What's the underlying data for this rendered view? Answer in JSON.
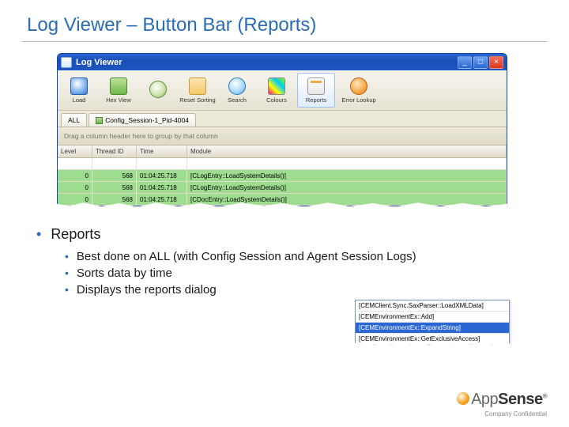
{
  "slide": {
    "title": "Log Viewer – Button Bar (Reports)"
  },
  "window": {
    "title": "Log Viewer",
    "min_label": "_",
    "max_label": "□",
    "close_label": "×"
  },
  "toolbar": {
    "load": "Load",
    "hex": "Hex View",
    "clock": "",
    "reset": "Reset Sorting",
    "search": "Search",
    "colors": "Colours",
    "reports": "Reports",
    "error": "Error Lookup"
  },
  "tabs": {
    "all": "ALL",
    "session": "Config_Session-1_Pid-4004"
  },
  "groupbar": "Drag a column header here to group by that column",
  "columns": {
    "level": "Level",
    "threadid": "Thread ID",
    "time": "Time",
    "module": "Module"
  },
  "rows": [
    {
      "level": "0",
      "tid": "568",
      "time": "01:04:25.718",
      "module": "[CLogEntry::LoadSystemDetails()]"
    },
    {
      "level": "0",
      "tid": "568",
      "time": "01:04:25.718",
      "module": "[CLogEntry::LoadSystemDetails()]"
    },
    {
      "level": "0",
      "tid": "568",
      "time": "01:04:25.718",
      "module": "[CDocEntry::LoadSystemDetails()]"
    }
  ],
  "popup": {
    "items": [
      "[CEMClient.Sync.SaxParser::LoadXMLData]",
      "[CEMEnvironmentEx::Add]",
      "[CEMEnvironmentEx::ExpandString]",
      "[CEMEnvironmentEx::GetExclusiveAccess]"
    ],
    "selected_index": 2
  },
  "bullets": {
    "l1": "Reports",
    "l2": [
      "Best done on ALL (with Config Session and Agent Session Logs)",
      "Sorts data by time",
      "Displays the reports dialog"
    ]
  },
  "footer": {
    "brand_light": "App",
    "brand_bold": "Sense",
    "tm": "®",
    "confidential": "Company Confidential"
  }
}
